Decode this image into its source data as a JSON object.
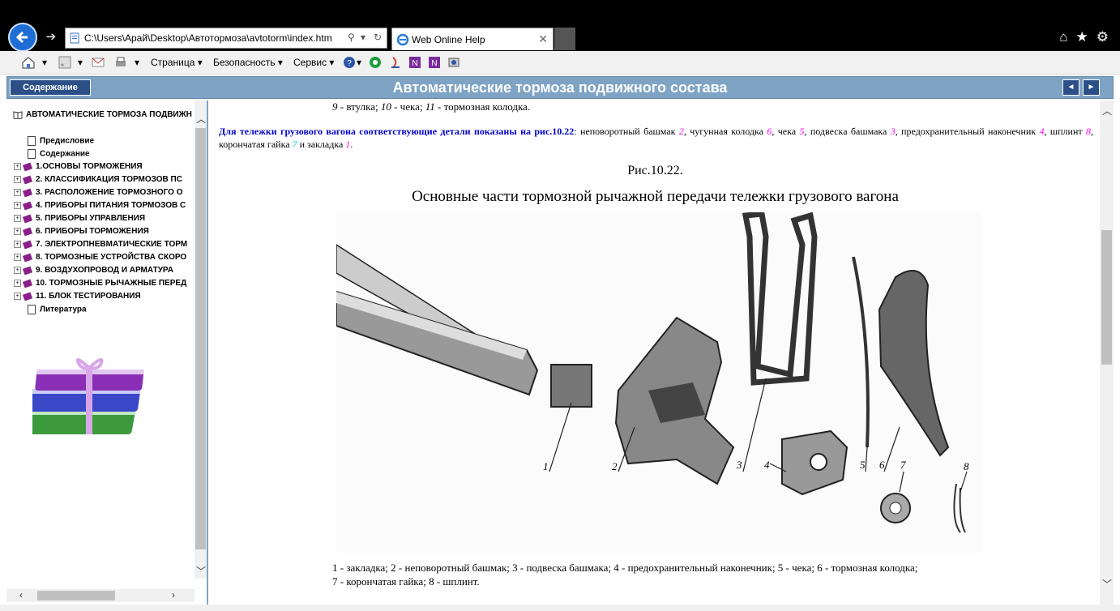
{
  "browser": {
    "url": "C:\\Users\\Арай\\Desktop\\Автотормоза\\avtotorm\\index.htm",
    "tab_title": "Web Online Help",
    "menu": {
      "page": "Страница ▾",
      "security": "Безопасность ▾",
      "service": "Сервис ▾"
    }
  },
  "header": {
    "toc_button": "Содержание",
    "title": "Автоматические тормоза подвижного состава",
    "prev": "◄",
    "next": "►"
  },
  "toc": {
    "root": "АВТОМАТИЧЕСКИЕ ТОРМОЗА ПОДВИЖН",
    "pages": [
      "Предисловие",
      "Содержание"
    ],
    "chapters": [
      "1.ОСНОВЫ ТОРМОЖЕНИЯ",
      "2. КЛАССИФИКАЦИЯ ТОРМОЗОВ ПС",
      "3. РАСПОЛОЖЕНИЕ ТОРМОЗНОГО О",
      "4. ПРИБОРЫ ПИТАНИЯ ТОРМОЗОВ С",
      "5. ПРИБОРЫ УПРАВЛЕНИЯ",
      "6. ПРИБОРЫ ТОРМОЖЕНИЯ",
      "7. ЭЛЕКТРОПНЕВМАТИЧЕСКИЕ ТОРМ",
      "8. ТОРМОЗНЫЕ УСТРОЙСТВА СКОРО",
      "9. ВОЗДУХОПРОВОД И АРМАТУРА",
      "10. ТОРМОЗНЫЕ РЫЧАЖНЫЕ ПЕРЕД",
      "11. БЛОК ТЕСТИРОВАНИЯ"
    ],
    "last": "Литература"
  },
  "content": {
    "top_caption": {
      "n9": "9",
      "t9": " - втулка; ",
      "n10": "10",
      "t10": " - чека; ",
      "n11": "11",
      "t11": " - тормозная колодка."
    },
    "para": {
      "lead": "Для тележки грузового вагона соответствующие детали показаны на рис.10.22",
      "a": ": неповоротный башмак ",
      "n2": "2",
      "b": ", чугунная колодка ",
      "n6": "6",
      "c": ", чека ",
      "n5": "5",
      "d": ", подвеска башмака ",
      "n3": "3",
      "e": ", предохранительный наконечник ",
      "n4": "4",
      "f": ", шплинт ",
      "n8": "8",
      "g": ", корончатая гайка ",
      "n7": "7",
      "h": " и закладка ",
      "n1": "1",
      "i": "."
    },
    "figure_number": "Рис.10.22.",
    "figure_title": "Основные части тормозной рычажной передачи тележки грузового вагона",
    "figure_labels": [
      "1",
      "2",
      "3",
      "4",
      "5",
      "6",
      "7",
      "8"
    ],
    "legend_line1": "1 - закладка; 2 - неповоротный башмак; 3 - подвеска башмака; 4 - предохранительный наконечник; 5 - чека; 6 - тормозная колодка;",
    "legend_line2": "7 - корончатая гайка; 8 - шплинт."
  }
}
